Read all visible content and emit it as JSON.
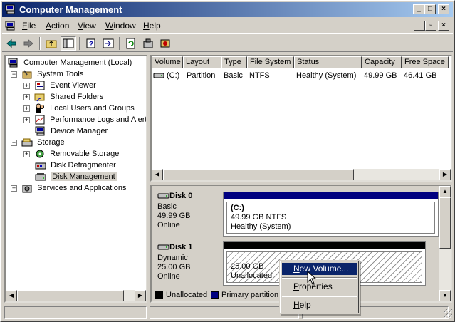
{
  "window": {
    "title": "Computer Management",
    "controls": [
      "_",
      "□",
      "×"
    ],
    "mdi_controls": [
      "_",
      "▫",
      "×"
    ]
  },
  "menu": [
    {
      "label": "File",
      "key": "F"
    },
    {
      "label": "Action",
      "key": "A"
    },
    {
      "label": "View",
      "key": "V"
    },
    {
      "label": "Window",
      "key": "W"
    },
    {
      "label": "Help",
      "key": "H"
    }
  ],
  "toolbar": {
    "buttons": [
      "back-icon",
      "forward-icon",
      "up-folder-icon",
      "show-tree-icon",
      "properties-icon",
      "export-icon",
      "refresh-icon",
      "settings-icon",
      "wizard-icon"
    ]
  },
  "tree": {
    "root": "Computer Management (Local)",
    "system_tools": "System Tools",
    "event_viewer": "Event Viewer",
    "shared_folders": "Shared Folders",
    "local_users": "Local Users and Groups",
    "perf_logs": "Performance Logs and Alerts",
    "device_manager": "Device Manager",
    "storage": "Storage",
    "removable_storage": "Removable Storage",
    "disk_defrag": "Disk Defragmenter",
    "disk_management": "Disk Management",
    "services_apps": "Services and Applications"
  },
  "volume_list": {
    "columns": [
      "Volume",
      "Layout",
      "Type",
      "File System",
      "Status",
      "Capacity",
      "Free Space"
    ],
    "rows": [
      {
        "volume": "(C:)",
        "layout": "Partition",
        "type": "Basic",
        "fs": "NTFS",
        "status": "Healthy (System)",
        "capacity": "49.99 GB",
        "free": "46.41 GB"
      }
    ]
  },
  "disks": [
    {
      "name": "Disk 0",
      "type": "Basic",
      "size": "49.99 GB",
      "state": "Online",
      "volume": {
        "name": "(C:)",
        "desc": "49.99 GB NTFS",
        "status": "Healthy (System)",
        "bar_color": "#000080"
      }
    },
    {
      "name": "Disk 1",
      "type": "Dynamic",
      "size": "25.00 GB",
      "state": "Online",
      "volume": {
        "size": "25.00 GB",
        "status": "Unallocated",
        "bar_color": "#000000"
      }
    }
  ],
  "legend": {
    "unallocated": {
      "label": "Unallocated",
      "color": "#000000"
    },
    "primary": {
      "label": "Primary partition",
      "color": "#000080"
    }
  },
  "context_menu": {
    "items": [
      {
        "label": "New Volume...",
        "mnemonic": "N",
        "highlighted": true
      },
      {
        "label": "Properties",
        "mnemonic": "P"
      },
      {
        "label": "Help",
        "mnemonic": "H"
      }
    ]
  }
}
